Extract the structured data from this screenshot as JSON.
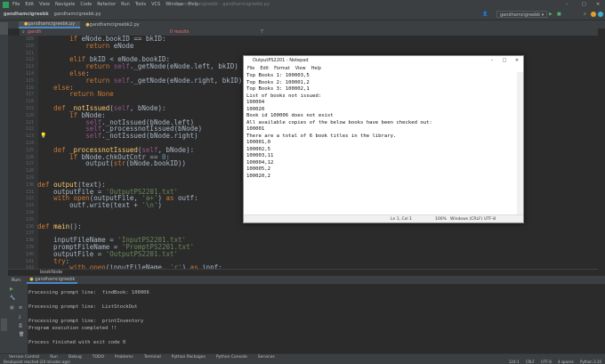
{
  "window": {
    "title": "gandhamcigreebk - gandhamcigreebk.py",
    "menu": [
      "File",
      "Edit",
      "View",
      "Navigate",
      "Code",
      "Refactor",
      "Run",
      "Tools",
      "VCS",
      "Window",
      "Help"
    ]
  },
  "navbar": {
    "project": "gandhamcigreebk",
    "file": "gandhamcigreebk.py",
    "run_config": "gandhamcigreebk"
  },
  "tabs": [
    {
      "label": "gandhamcigreebk.py",
      "active": true
    },
    {
      "label": "gandhamcigreebk2.py",
      "active": false
    }
  ],
  "find": {
    "value": "gandh",
    "results": "0 results"
  },
  "editor": {
    "lines": [
      {
        "n": "109",
        "code": [
          [
            "        "
          ],
          [
            "if",
            "kw"
          ],
          [
            " eNode.bookID == bkID:"
          ]
        ]
      },
      {
        "n": "110",
        "code": [
          [
            "            "
          ],
          [
            "return",
            "kw"
          ],
          [
            " eNode"
          ]
        ]
      },
      {
        "n": "111",
        "code": [
          [
            ""
          ]
        ]
      },
      {
        "n": "112",
        "code": [
          [
            "        "
          ],
          [
            "elif",
            "kw"
          ],
          [
            " bkID < eNode.bookID:"
          ]
        ]
      },
      {
        "n": "113",
        "code": [
          [
            "            "
          ],
          [
            "return",
            "kw"
          ],
          [
            " "
          ],
          [
            "self",
            "sf"
          ],
          [
            "._getNode(eNode.left, bkID)"
          ]
        ]
      },
      {
        "n": "114",
        "code": [
          [
            "        "
          ],
          [
            "else",
            "kw"
          ],
          [
            ":"
          ]
        ]
      },
      {
        "n": "115",
        "code": [
          [
            "            "
          ],
          [
            "return",
            "kw"
          ],
          [
            " "
          ],
          [
            "self",
            "sf"
          ],
          [
            "._getNode(eNode.right, bkID)"
          ]
        ]
      },
      {
        "n": "116",
        "code": [
          [
            "    "
          ],
          [
            "else",
            "kw"
          ],
          [
            ":"
          ]
        ]
      },
      {
        "n": "117",
        "code": [
          [
            "        "
          ],
          [
            "return None",
            "kw"
          ]
        ]
      },
      {
        "n": "118",
        "code": [
          [
            ""
          ]
        ]
      },
      {
        "n": "119",
        "code": [
          [
            "    "
          ],
          [
            "def",
            "kw"
          ],
          [
            " "
          ],
          [
            "_notIssued",
            "fn"
          ],
          [
            "("
          ],
          [
            "self",
            "sf"
          ],
          [
            ", bNode):"
          ]
        ]
      },
      {
        "n": "120",
        "code": [
          [
            "        "
          ],
          [
            "if",
            "kw"
          ],
          [
            " bNode:"
          ]
        ]
      },
      {
        "n": "121",
        "code": [
          [
            "            "
          ],
          [
            "self",
            "sf"
          ],
          [
            "._notIssued(bNode.left)"
          ]
        ]
      },
      {
        "n": "122",
        "code": [
          [
            "            "
          ],
          [
            "self",
            "sf"
          ],
          [
            "._processnotIssued(bNode)"
          ]
        ]
      },
      {
        "n": "123",
        "code": [
          [
            "            "
          ],
          [
            "self",
            "sf"
          ],
          [
            "._notIssued(bNode.right)"
          ]
        ]
      },
      {
        "n": "124",
        "code": [
          [
            ""
          ]
        ]
      },
      {
        "n": "125",
        "code": [
          [
            "    "
          ],
          [
            "def",
            "kw"
          ],
          [
            " "
          ],
          [
            "_processnotIssued",
            "fn"
          ],
          [
            "("
          ],
          [
            "self",
            "sf"
          ],
          [
            ", bNode):"
          ]
        ]
      },
      {
        "n": "126",
        "code": [
          [
            "        "
          ],
          [
            "if",
            "kw"
          ],
          [
            " bNode.chkOutCntr == "
          ],
          [
            "0",
            "nu"
          ],
          [
            ":"
          ]
        ]
      },
      {
        "n": "127",
        "code": [
          [
            "            output("
          ],
          [
            "str",
            "kw"
          ],
          [
            "(bNode.bookID))"
          ]
        ]
      },
      {
        "n": "128",
        "code": [
          [
            ""
          ]
        ]
      },
      {
        "n": "129",
        "code": [
          [
            ""
          ]
        ]
      },
      {
        "n": "130",
        "code": [
          [
            "def",
            "kw"
          ],
          [
            " "
          ],
          [
            "output",
            "fn"
          ],
          [
            "(text):"
          ]
        ]
      },
      {
        "n": "131",
        "code": [
          [
            "    outputFile = "
          ],
          [
            "'OutputPS2201.txt'",
            "st"
          ]
        ]
      },
      {
        "n": "132",
        "code": [
          [
            "    "
          ],
          [
            "with",
            "kw"
          ],
          [
            " "
          ],
          [
            "open",
            "kw"
          ],
          [
            "(outputFile, "
          ],
          [
            "'a+'",
            "st"
          ],
          [
            ") "
          ],
          [
            "as",
            "kw"
          ],
          [
            " outf:"
          ]
        ]
      },
      {
        "n": "133",
        "code": [
          [
            "        outf.write(text + "
          ],
          [
            "'\\n'",
            "st"
          ],
          [
            ")"
          ]
        ]
      },
      {
        "n": "134",
        "code": [
          [
            ""
          ]
        ]
      },
      {
        "n": "135",
        "code": [
          [
            ""
          ]
        ]
      },
      {
        "n": "136",
        "code": [
          [
            "def",
            "kw"
          ],
          [
            " "
          ],
          [
            "main",
            "fn"
          ],
          [
            "():"
          ]
        ]
      },
      {
        "n": "137",
        "code": [
          [
            ""
          ]
        ]
      },
      {
        "n": "138",
        "code": [
          [
            "    inputFileName = "
          ],
          [
            "'InputPS2201.txt'",
            "st"
          ]
        ]
      },
      {
        "n": "139",
        "code": [
          [
            "    promptFileName = "
          ],
          [
            "'PromptPS2201.txt'",
            "st"
          ]
        ]
      },
      {
        "n": "140",
        "code": [
          [
            "    outputFile = "
          ],
          [
            "'OutputPS2201.txt'",
            "st"
          ]
        ]
      },
      {
        "n": "141",
        "code": [
          [
            "    "
          ],
          [
            "try",
            "kw"
          ],
          [
            ":"
          ]
        ]
      },
      {
        "n": "142",
        "code": [
          [
            "        "
          ],
          [
            "with",
            "kw"
          ],
          [
            " "
          ],
          [
            "open",
            "kw"
          ],
          [
            "(inputFileName, "
          ],
          [
            "'r'",
            "st"
          ],
          [
            ") "
          ],
          [
            "as",
            "kw"
          ],
          [
            " inpf:"
          ]
        ]
      }
    ]
  },
  "breadcrumb": "bookNode",
  "run": {
    "label": "Run:",
    "config": "gandhamcigreebk",
    "console": "Processing prompt line:  findBook: 100006\n\nProcessing prompt line:  ListStockOut\n\nProcessing prompt line:  printInventory\nProgram execution completed !!\n\nProcess finished with exit code 0"
  },
  "toolwindows": [
    "Version Control",
    "Run",
    "Debug",
    "TODO",
    "Problems",
    "Terminal",
    "Python Packages",
    "Python Console",
    "Services"
  ],
  "status": {
    "message": "Breakpoint reached (20 minutes ago)",
    "position": "124:1",
    "line_sep": "CRLF",
    "encoding": "UTF-8",
    "indent": "4 spaces",
    "interpreter": "Python 3.10"
  },
  "notepad": {
    "title": "OutputPS2201 - Notepad",
    "menu": [
      "File",
      "Edit",
      "Format",
      "View",
      "Help"
    ],
    "text": "Top Books 1: 100003,5\nTop Books 2: 100001,2\nTop Books 3: 100002,1\nList of books not issued:\n100004\n100020\nBook id 100006 does not exist\nAll available copies of the below books have been checked out:\n100001\nThere are a total of 6 book titles in the library.\n100001,0\n100002,5\n100003,11\n100004,12\n100005,2\n100020,2",
    "status": {
      "position": "Ln 1, Col 1",
      "zoom": "100%",
      "line_ending": "Windows (CRLF)",
      "encoding": "UTF-8"
    }
  },
  "colors": {
    "accent": "#4a88c7",
    "run_green": "#59a869",
    "keyword": "#cc7832",
    "string": "#6a8759"
  }
}
